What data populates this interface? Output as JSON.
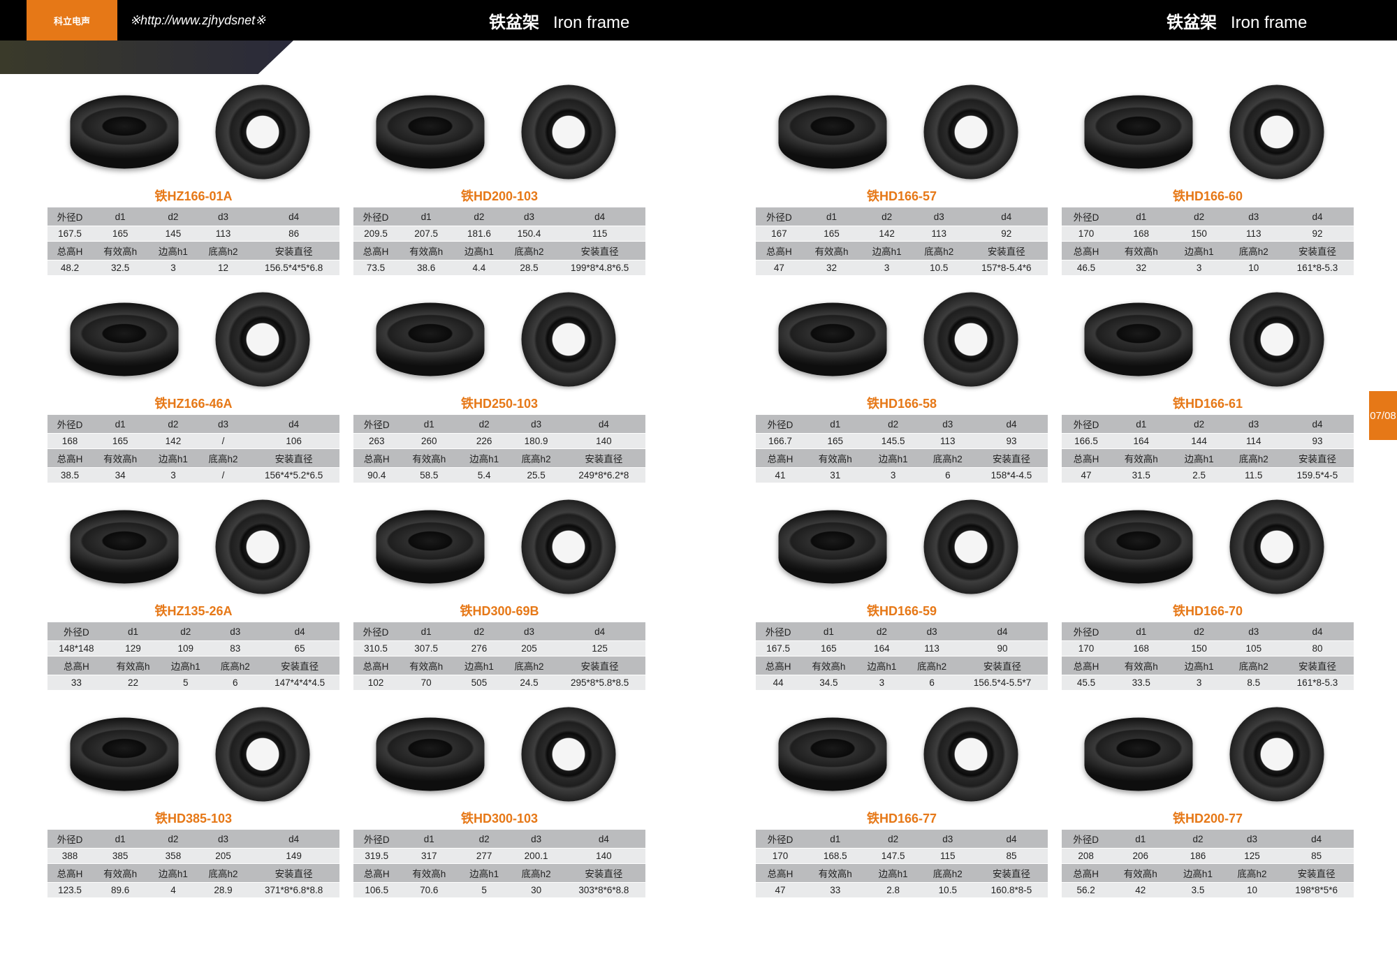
{
  "header": {
    "url": "※http://www.zjhydsnet※",
    "title_cn": "铁盆架",
    "title_en": "Iron frame",
    "logo": "科立电声"
  },
  "pagetab": "07/08",
  "table_headers": {
    "r1": [
      "外径D",
      "d1",
      "d2",
      "d3",
      "d4"
    ],
    "r2": [
      "总高H",
      "有效高h",
      "边高h1",
      "底高h2",
      "安装直径"
    ]
  },
  "products": [
    {
      "name": "铁HZ166-01A",
      "r1": [
        "167.5",
        "165",
        "145",
        "113",
        "86"
      ],
      "r2": [
        "48.2",
        "32.5",
        "3",
        "12",
        "156.5*4*5*6.8"
      ]
    },
    {
      "name": "铁HD200-103",
      "r1": [
        "209.5",
        "207.5",
        "181.6",
        "150.4",
        "115"
      ],
      "r2": [
        "73.5",
        "38.6",
        "4.4",
        "28.5",
        "199*8*4.8*6.5"
      ]
    },
    {
      "name": "铁HZ166-46A",
      "r1": [
        "168",
        "165",
        "142",
        "/",
        "106"
      ],
      "r2": [
        "38.5",
        "34",
        "3",
        "/",
        "156*4*5.2*6.5"
      ]
    },
    {
      "name": "铁HD250-103",
      "r1": [
        "263",
        "260",
        "226",
        "180.9",
        "140"
      ],
      "r2": [
        "90.4",
        "58.5",
        "5.4",
        "25.5",
        "249*8*6.2*8"
      ]
    },
    {
      "name": "铁HZ135-26A",
      "r1": [
        "148*148",
        "129",
        "109",
        "83",
        "65"
      ],
      "r2": [
        "33",
        "22",
        "5",
        "6",
        "147*4*4*4.5"
      ]
    },
    {
      "name": "铁HD300-69B",
      "r1": [
        "310.5",
        "307.5",
        "276",
        "205",
        "125"
      ],
      "r2": [
        "102",
        "70",
        "505",
        "24.5",
        "295*8*5.8*8.5"
      ]
    },
    {
      "name": "铁HD385-103",
      "r1": [
        "388",
        "385",
        "358",
        "205",
        "149"
      ],
      "r2": [
        "123.5",
        "89.6",
        "4",
        "28.9",
        "371*8*6.8*8.8"
      ]
    },
    {
      "name": "铁HD300-103",
      "r1": [
        "319.5",
        "317",
        "277",
        "200.1",
        "140"
      ],
      "r2": [
        "106.5",
        "70.6",
        "5",
        "30",
        "303*8*6*8.8"
      ]
    },
    {
      "name": "铁HD166-57",
      "r1": [
        "167",
        "165",
        "142",
        "113",
        "92"
      ],
      "r2": [
        "47",
        "32",
        "3",
        "10.5",
        "157*8-5.4*6"
      ]
    },
    {
      "name": "铁HD166-60",
      "r1": [
        "170",
        "168",
        "150",
        "113",
        "92"
      ],
      "r2": [
        "46.5",
        "32",
        "3",
        "10",
        "161*8-5.3"
      ]
    },
    {
      "name": "铁HD166-58",
      "r1": [
        "166.7",
        "165",
        "145.5",
        "113",
        "93"
      ],
      "r2": [
        "41",
        "31",
        "3",
        "6",
        "158*4-4.5"
      ]
    },
    {
      "name": "铁HD166-61",
      "r1": [
        "166.5",
        "164",
        "144",
        "114",
        "93"
      ],
      "r2": [
        "47",
        "31.5",
        "2.5",
        "11.5",
        "159.5*4-5"
      ]
    },
    {
      "name": "铁HD166-59",
      "r1": [
        "167.5",
        "165",
        "164",
        "113",
        "90"
      ],
      "r2": [
        "44",
        "34.5",
        "3",
        "6",
        "156.5*4-5.5*7"
      ]
    },
    {
      "name": "铁HD166-70",
      "r1": [
        "170",
        "168",
        "150",
        "105",
        "80"
      ],
      "r2": [
        "45.5",
        "33.5",
        "3",
        "8.5",
        "161*8-5.3"
      ]
    },
    {
      "name": "铁HD166-77",
      "r1": [
        "170",
        "168.5",
        "147.5",
        "115",
        "85"
      ],
      "r2": [
        "47",
        "33",
        "2.8",
        "10.5",
        "160.8*8-5"
      ]
    },
    {
      "name": "铁HD200-77",
      "r1": [
        "208",
        "206",
        "186",
        "125",
        "85"
      ],
      "r2": [
        "56.2",
        "42",
        "3.5",
        "10",
        "198*8*5*6"
      ]
    }
  ]
}
